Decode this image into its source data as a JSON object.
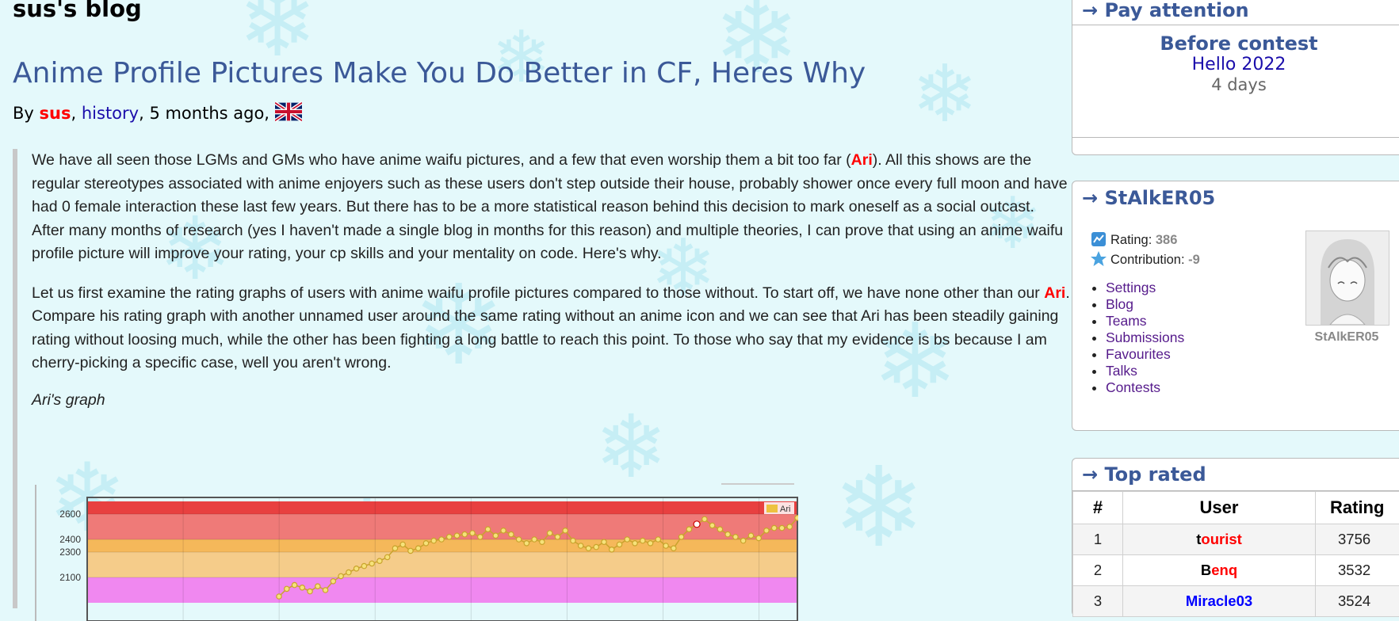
{
  "blog": {
    "name": "sus's blog"
  },
  "post": {
    "title": "Anime Profile Pictures Make You Do Better in CF, Heres Why",
    "by": "By",
    "author": "sus",
    "history_link": "history",
    "time": ", 5 months ago,",
    "paragraphs": [
      {
        "before": "We have all seen those LGMs and GMs who have anime waifu pictures, and a few that even worship them a bit too far (",
        "highlight": "Ari",
        "after": "). All this shows are the regular stereotypes associated with anime enjoyers such as these users don't step outside their house, probably shower once every full moon and have had 0 female interaction these last few years. But there has to be a more statistical reason behind this decision to mark oneself as a social outcast. After many months of research (yes I haven't made a single blog in months for this reason) and multiple theories, I can prove that using an anime waifu profile picture will improve your rating, your cp skills and your mentality on code. Here's why."
      },
      {
        "before": "Let us first examine the rating graphs of users with anime waifu profile pictures compared to those without. To start off, we have none other than our ",
        "highlight": "Ari",
        "after": ". Compare his rating graph with another unnamed user around the same rating without an anime icon and we can see that Ari has been steadily gaining rating without loosing much, while the other has been fighting a long battle to reach this point. To those who say that my evidence is bs because I am cherry-picking a specific case, well you aren't wrong."
      }
    ],
    "caption": "Ari's graph"
  },
  "chart_data": {
    "type": "line",
    "title": "",
    "xlabel": "",
    "ylabel": "",
    "yticks": [
      2100,
      2300,
      2400,
      2600
    ],
    "ylim": [
      1900,
      2700
    ],
    "grid": true,
    "legend_position": "top-right",
    "bands": [
      {
        "from": 1900,
        "to": 2100,
        "color": "#f088f0"
      },
      {
        "from": 2100,
        "to": 2300,
        "color": "#f5cc8a"
      },
      {
        "from": 2300,
        "to": 2400,
        "color": "#f5b85a"
      },
      {
        "from": 2400,
        "to": 2600,
        "color": "#ef7a78"
      },
      {
        "from": 2600,
        "to": 2700,
        "color": "#e84040"
      }
    ],
    "series": [
      {
        "name": "Ari",
        "color": "#edc240",
        "x": [
          1,
          2,
          3,
          4,
          5,
          6,
          7,
          8,
          9,
          10,
          11,
          12,
          13,
          14,
          15,
          16,
          17,
          18,
          19,
          20,
          21,
          22,
          23,
          24,
          25,
          26,
          27,
          28,
          29,
          30,
          31,
          32,
          33,
          34,
          35,
          36,
          37,
          38,
          39,
          40,
          41,
          42,
          43,
          44,
          45,
          46,
          47,
          48,
          49,
          50,
          51,
          52,
          53,
          54,
          55,
          56,
          57,
          58,
          59,
          60,
          61,
          62,
          63,
          64,
          65,
          66,
          67,
          68
        ],
        "values": [
          1950,
          2010,
          2040,
          2020,
          1990,
          2030,
          2000,
          2070,
          2110,
          2140,
          2170,
          2190,
          2210,
          2230,
          2260,
          2330,
          2360,
          2310,
          2330,
          2370,
          2390,
          2400,
          2420,
          2430,
          2440,
          2450,
          2420,
          2480,
          2430,
          2470,
          2440,
          2400,
          2370,
          2400,
          2380,
          2450,
          2420,
          2470,
          2390,
          2350,
          2330,
          2340,
          2380,
          2320,
          2360,
          2400,
          2370,
          2390,
          2370,
          2400,
          2350,
          2330,
          2420,
          2480,
          2520,
          2560,
          2510,
          2480,
          2440,
          2420,
          2390,
          2430,
          2410,
          2470,
          2490,
          2490,
          2500,
          2570
        ],
        "highlight_index": 54
      }
    ]
  },
  "sidebar": {
    "pay_attention": {
      "title": "→ Pay attention",
      "before_label": "Before contest",
      "contest": "Hello 2022",
      "countdown": "4 days"
    },
    "user": {
      "title": "→ StAlkER05",
      "rating_label": "Rating:",
      "rating": "386",
      "contribution_label": "Contribution:",
      "contribution": "-9",
      "menu": [
        "Settings",
        "Blog",
        "Teams",
        "Submissions",
        "Favourites",
        "Talks",
        "Contests"
      ],
      "avatar_name": "StAlkER05"
    },
    "top_rated": {
      "title": "→ Top rated",
      "headers": [
        "#",
        "User",
        "Rating"
      ],
      "rows": [
        {
          "rank": "1",
          "first": "t",
          "rest": "ourist",
          "color": "#ff0000",
          "rating": "3756"
        },
        {
          "rank": "2",
          "first": "B",
          "rest": "enq",
          "color": "#ff0000",
          "rating": "3532"
        },
        {
          "rank": "3",
          "first": "",
          "rest": "Miracle03",
          "color": "#0000ff",
          "rating": "3524"
        }
      ]
    }
  },
  "colors": {
    "link": "#1a0dab",
    "visited_link": "#551a8b",
    "title_blue": "#3b5998",
    "legendary_red": "#ff0000",
    "background": "#e4f9fb"
  }
}
